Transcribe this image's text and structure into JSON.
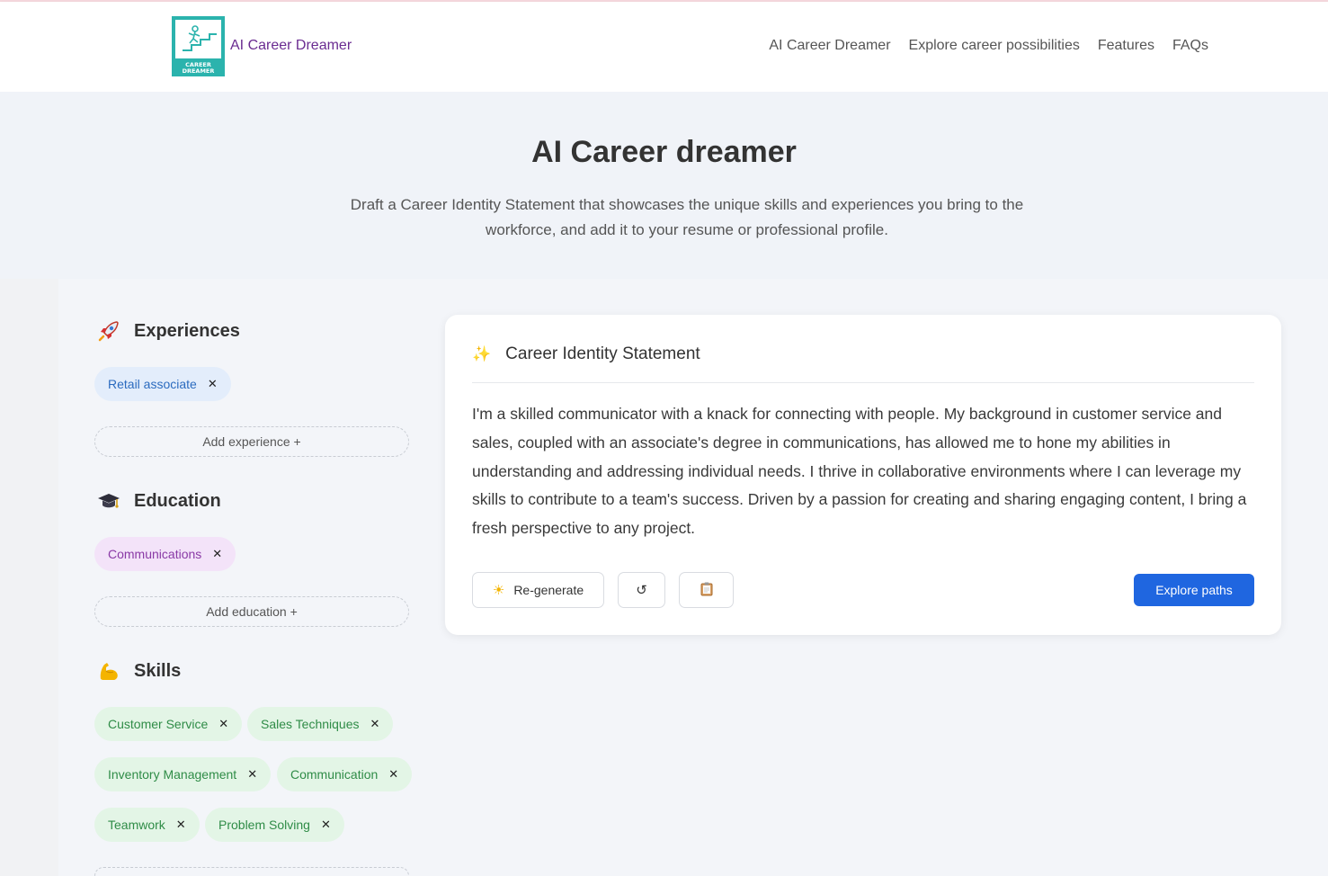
{
  "header": {
    "brand": "AI Career Dreamer",
    "logo_text": "CAREER DREAMER",
    "nav": [
      "AI Career Dreamer",
      "Explore career possibilities",
      "Features",
      "FAQs"
    ]
  },
  "hero": {
    "title": "AI Career dreamer",
    "subtitle": "Draft a Career Identity Statement that showcases the unique skills and experiences you bring to the workforce, and add it to your resume or professional profile."
  },
  "experiences": {
    "title": "Experiences",
    "icon": "rocket-icon",
    "chips": [
      "Retail associate"
    ],
    "add_label": "Add experience +"
  },
  "education": {
    "title": "Education",
    "icon": "graduation-cap-icon",
    "chips": [
      "Communications"
    ],
    "add_label": "Add education +"
  },
  "skills": {
    "title": "Skills",
    "icon": "flexed-bicep-icon",
    "chips": [
      "Customer Service",
      "Sales Techniques",
      "Inventory Management",
      "Communication",
      "Teamwork",
      "Problem Solving"
    ]
  },
  "card": {
    "title": "Career Identity Statement",
    "statement": "I'm a skilled communicator with a knack for connecting with people. My background in customer service and sales, coupled with an associate's degree in communications, has allowed me to hone my abilities in understanding and addressing individual needs. I thrive in collaborative environments where I can leverage my skills to contribute to a team's success. Driven by a passion for creating and sharing engaging content, I bring a fresh perspective to any project.",
    "regenerate_label": "Re-generate",
    "explore_label": "Explore paths"
  },
  "colors": {
    "brand": "#6a2c91",
    "primary": "#1f66e0",
    "logo_teal": "#2bb3ad"
  }
}
